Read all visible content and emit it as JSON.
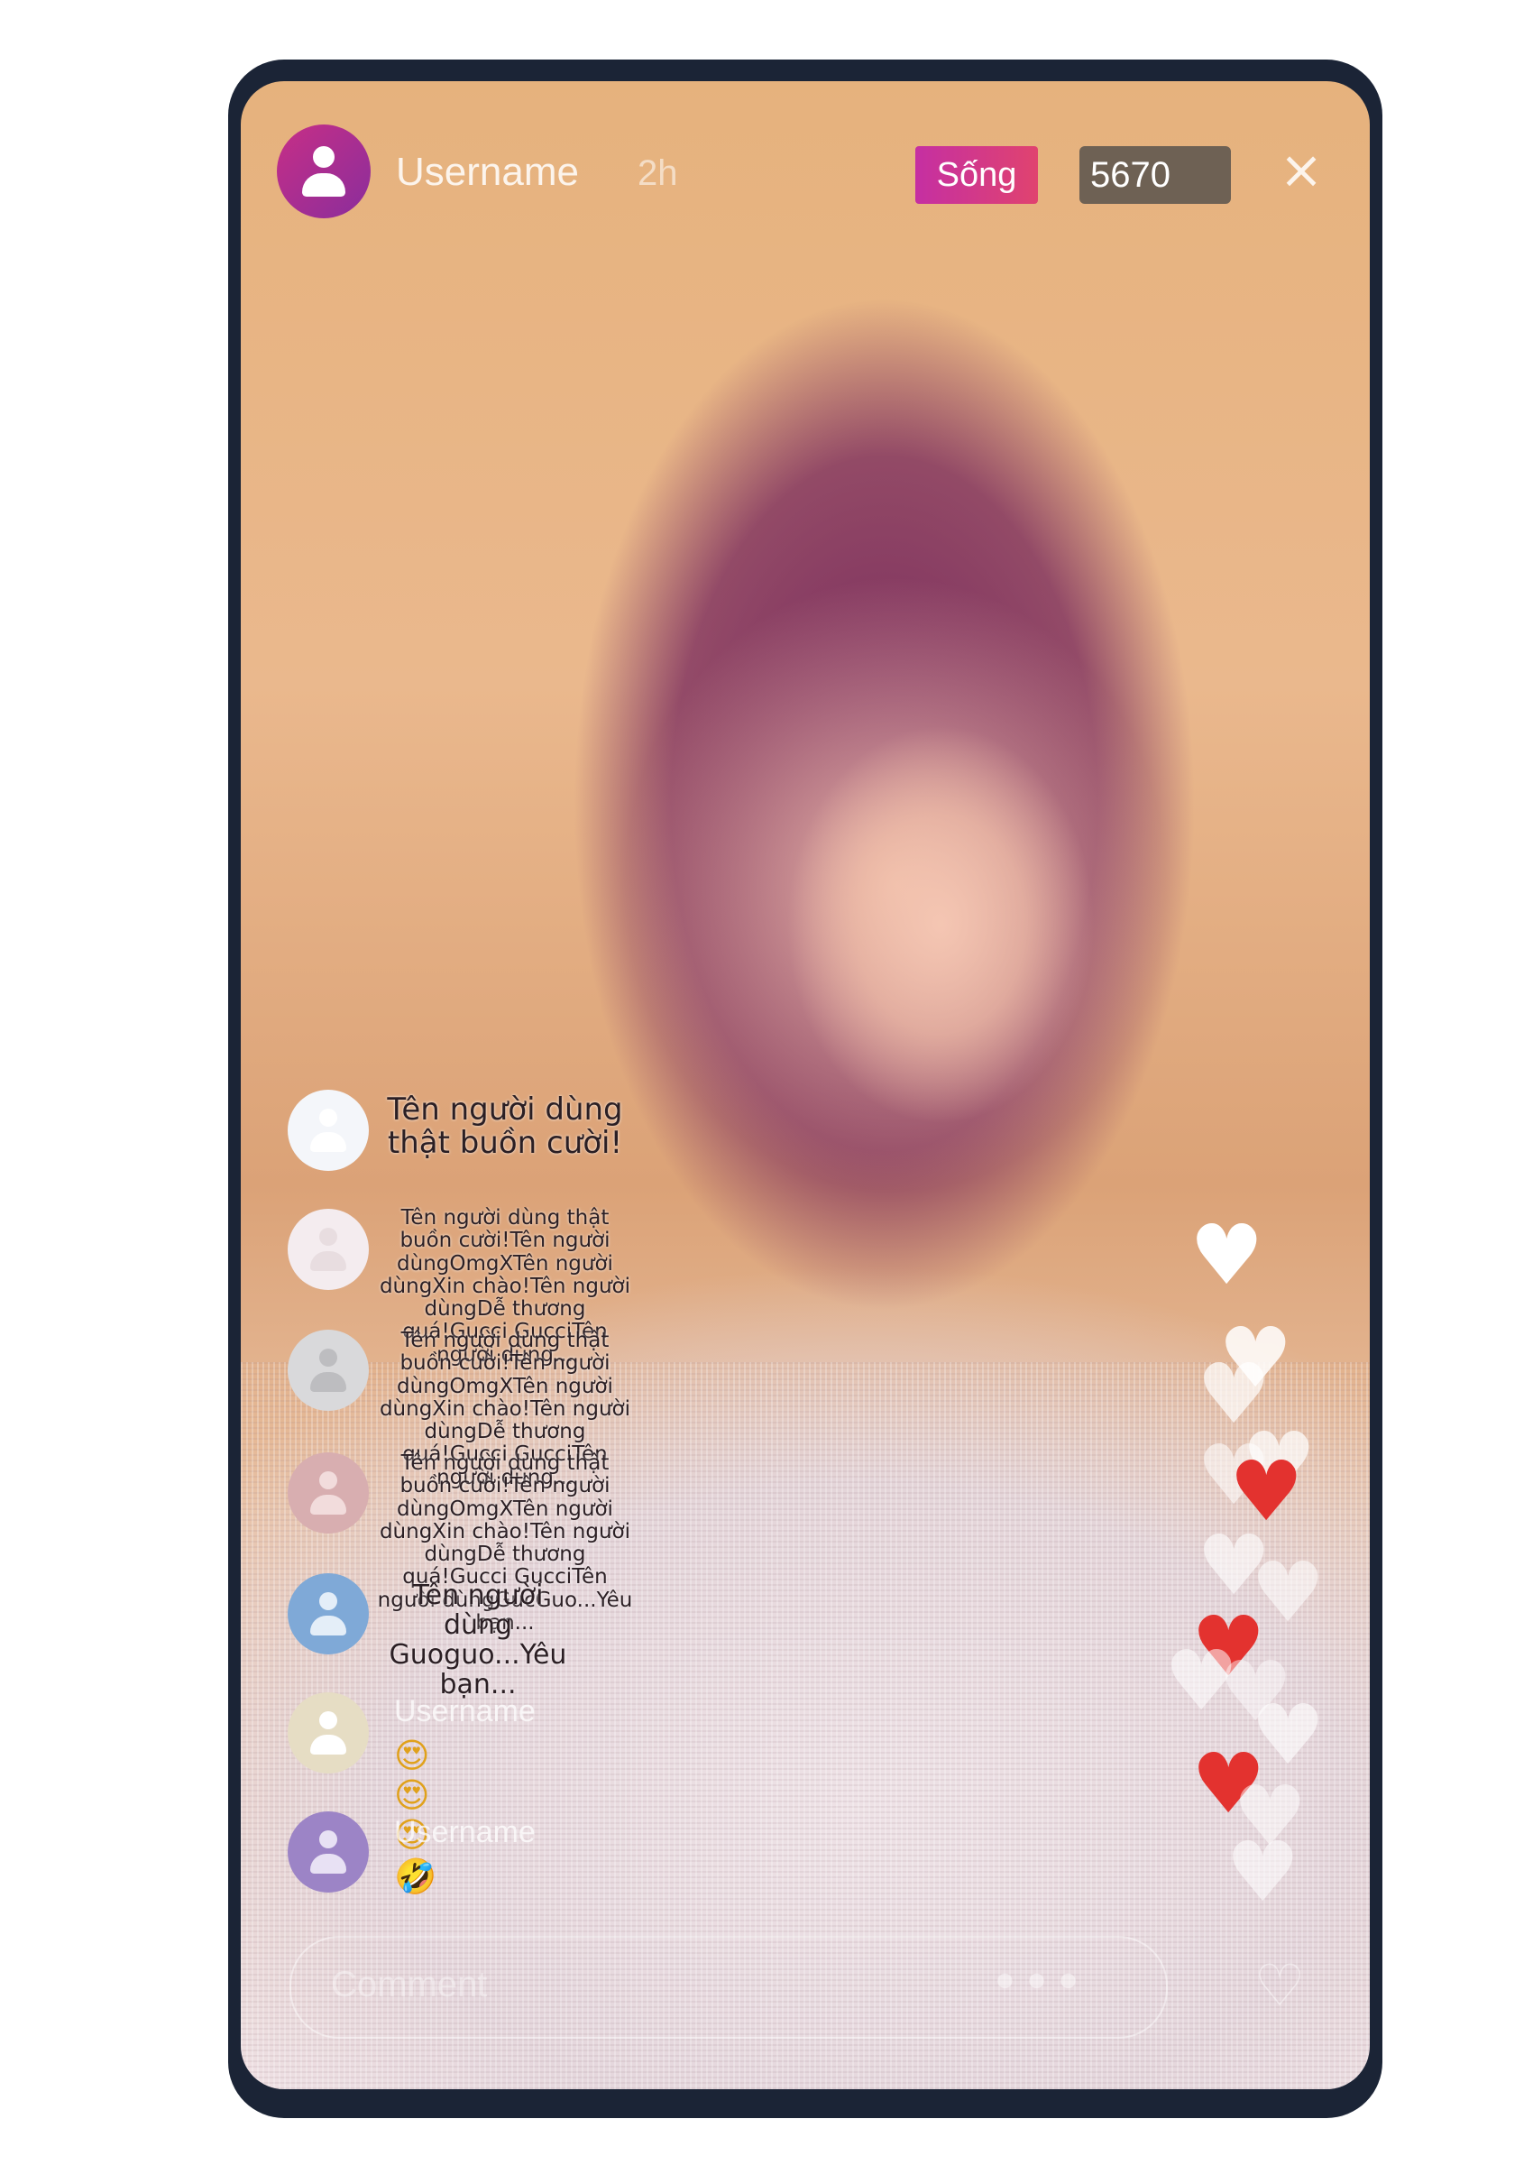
{
  "header": {
    "username": "Username",
    "time_ago": "2h",
    "live_label": "Sống",
    "viewer_count": "5670",
    "close_icon": "×"
  },
  "comments": [
    {
      "text": "Tên người dùng thật buồn cười!",
      "avatar_color": "#f4f6fa"
    },
    {
      "text": "Tên người dùng thật buồn cười!Tên người dùngOmgXTên người dùngXin chào!Tên người dùngDễ thương quá!Gucci GucciTên người dùng...",
      "avatar_color": "#f4ecef"
    },
    {
      "text": "Tên người dùng thật buồn cười!Tên người dùngOmgXTên người dùngXin chào!Tên người dùngDễ thương quá!Gucci GucciTên người dùng...",
      "avatar_color": "#d9d9db"
    },
    {
      "text": "Tên người dùng thật buồn cười!Tên người dùngOmgXTên người dùngXin chào!Tên người dùngDễ thương quá!Gucci GucciTên người dùngGucGuo...Yêu bạn...",
      "avatar_color": "#d8aeb0"
    },
    {
      "text": "Tên người dùng Guoguo...Yêu bạn...",
      "avatar_color": "#7fa9d7"
    },
    {
      "username": "Username",
      "emoji": "😍 😍 😍",
      "avatar_color": "#e6ddc4"
    },
    {
      "username": "Username",
      "emoji": "🤣",
      "avatar_color": "#9c84c6"
    }
  ],
  "hearts": {
    "white": "♥",
    "red": "♥",
    "colors": {
      "white": "#ffffff",
      "red": "#e3322f"
    }
  },
  "footer": {
    "comment_placeholder": "Comment",
    "more_icon": "•••",
    "heart_button_icon": "♡"
  }
}
